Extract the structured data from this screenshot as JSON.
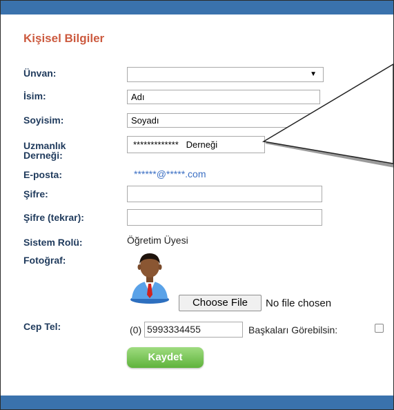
{
  "section_title": "Kişisel Bilgiler",
  "labels": {
    "unvan": "Ünvan:",
    "isim": "İsim:",
    "soyisim": "Soyisim:",
    "uzmanlik_1": "Uzmanlık",
    "uzmanlik_2": "Derneği:",
    "eposta": "E-posta:",
    "sifre": "Şifre:",
    "sifre_tekrar": "Şifre (tekrar):",
    "sistem_rolu": "Sistem Rolü:",
    "fotograf": "Fotoğraf:",
    "cep_tel": "Cep Tel:"
  },
  "fields": {
    "unvan_value": "",
    "isim_value": "Adı",
    "soyisim_value": "Soyadı",
    "uzmanlik_value": "*************   Derneği",
    "eposta_value": "******@*****.com",
    "sifre_value": "",
    "sifre_tekrar_value": "",
    "sistem_rolu_value": "Öğretim Üyesi",
    "cep_tel_prefix": "(0)",
    "cep_tel_value": "5993334455",
    "visibility_label": "Başkaları Görebilsin:",
    "visibility_checked": false
  },
  "file_upload": {
    "button_label": "Choose File",
    "status_text": "No file chosen"
  },
  "actions": {
    "save_label": "Kaydet"
  },
  "icons": {
    "select_arrow": "▼",
    "avatar": "user-avatar-icon"
  },
  "colors": {
    "header_bar": "#3a72ad",
    "title": "#cc5a3f",
    "label": "#1f3a5c",
    "email_link": "#3b6fc3",
    "save_button": "#5fb33c"
  }
}
